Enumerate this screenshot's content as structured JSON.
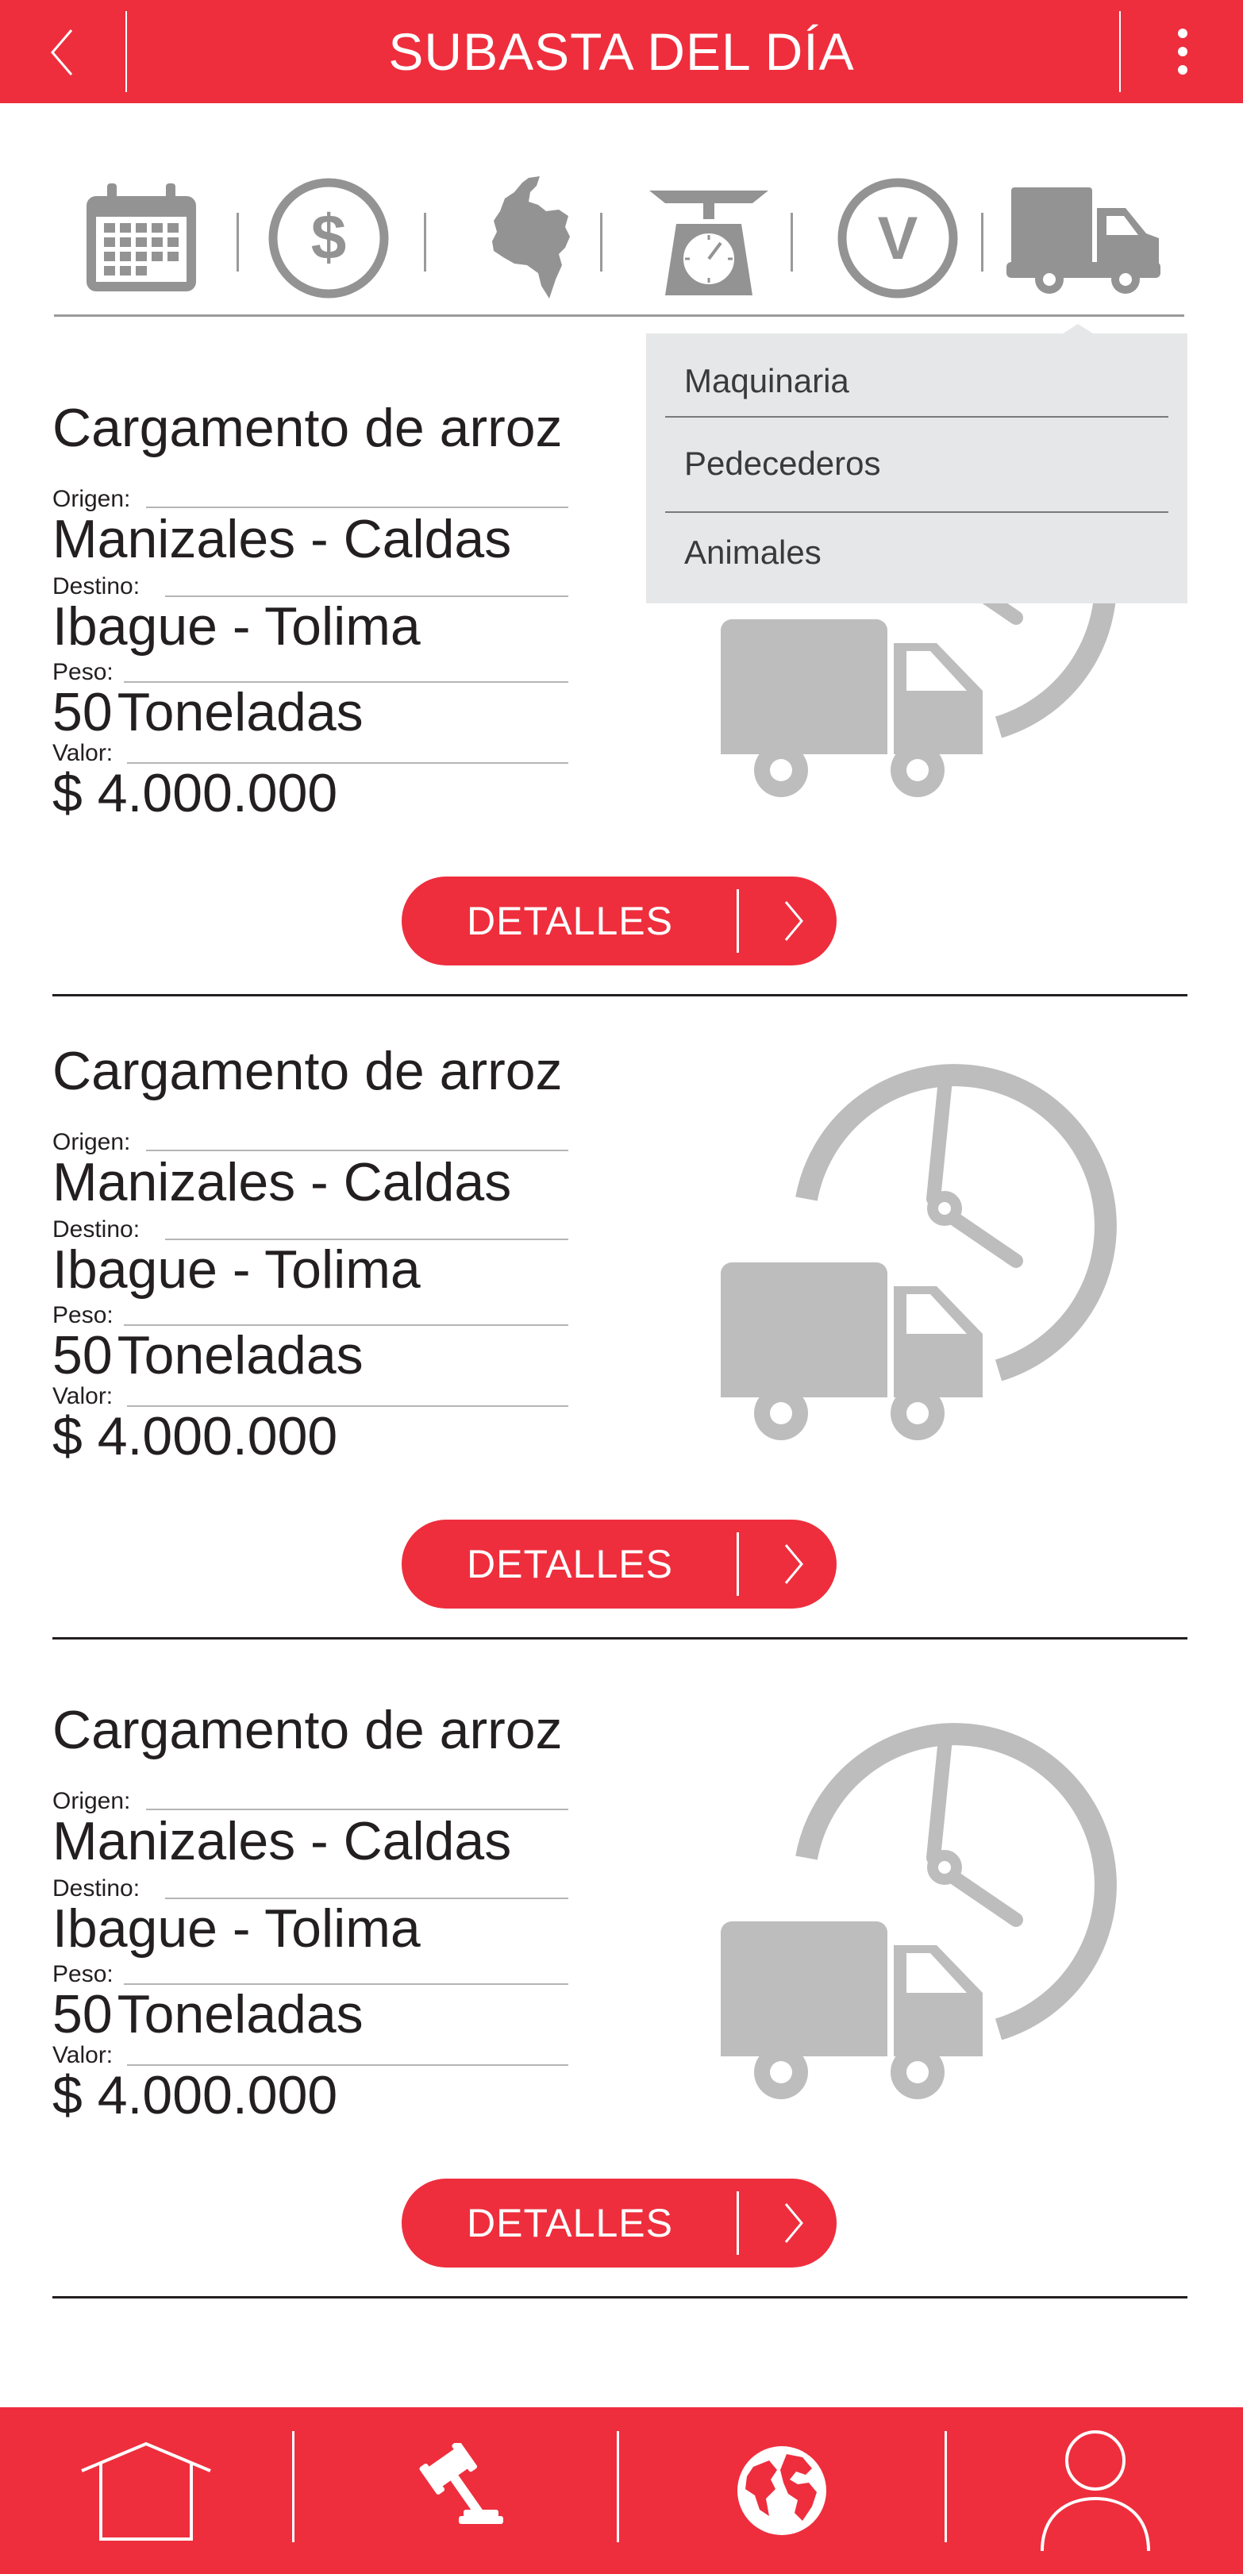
{
  "header": {
    "title": "SUBASTA DEL DÍA",
    "back_icon": "chevron-left-icon",
    "menu_icon": "more-vertical-icon",
    "color": "#ee2e3d"
  },
  "filters": {
    "icons": [
      "calendar-icon",
      "dollar-icon",
      "colombia-map-icon",
      "scale-icon",
      "value-icon",
      "truck-icon"
    ],
    "value_icon_letter": "V",
    "active": "truck-icon",
    "icon_color": "#939393"
  },
  "dropdown": {
    "items": [
      "Maquinaria",
      "Pedecederos",
      "Animales"
    ]
  },
  "cards": [
    {
      "title": "Cargamento de arroz",
      "origin_label": "Origen:",
      "origin": "Manizales - Caldas",
      "destination_label": "Destino:",
      "destination": "Ibague - Tolima",
      "weight_label": "Peso:",
      "weight_amount": "50",
      "weight_unit": "Toneladas",
      "value_label": "Valor:",
      "value": "$ 4.000.000",
      "button_label": "DETALLES"
    },
    {
      "title": "Cargamento de arroz",
      "origin_label": "Origen:",
      "origin": "Manizales - Caldas",
      "destination_label": "Destino:",
      "destination": "Ibague - Tolima",
      "weight_label": "Peso:",
      "weight_amount": "50",
      "weight_unit": "Toneladas",
      "value_label": "Valor:",
      "value": "$ 4.000.000",
      "button_label": "DETALLES"
    },
    {
      "title": "Cargamento de arroz",
      "origin_label": "Origen:",
      "origin": "Manizales - Caldas",
      "destination_label": "Destino:",
      "destination": "Ibague - Tolima",
      "weight_label": "Peso:",
      "weight_amount": "50",
      "weight_unit": "Toneladas",
      "value_label": "Valor:",
      "value": "$ 4.000.000",
      "button_label": "DETALLES"
    }
  ],
  "bottom_nav": {
    "items": [
      "home-icon",
      "auction-gavel-icon",
      "globe-icon",
      "user-profile-icon"
    ]
  }
}
